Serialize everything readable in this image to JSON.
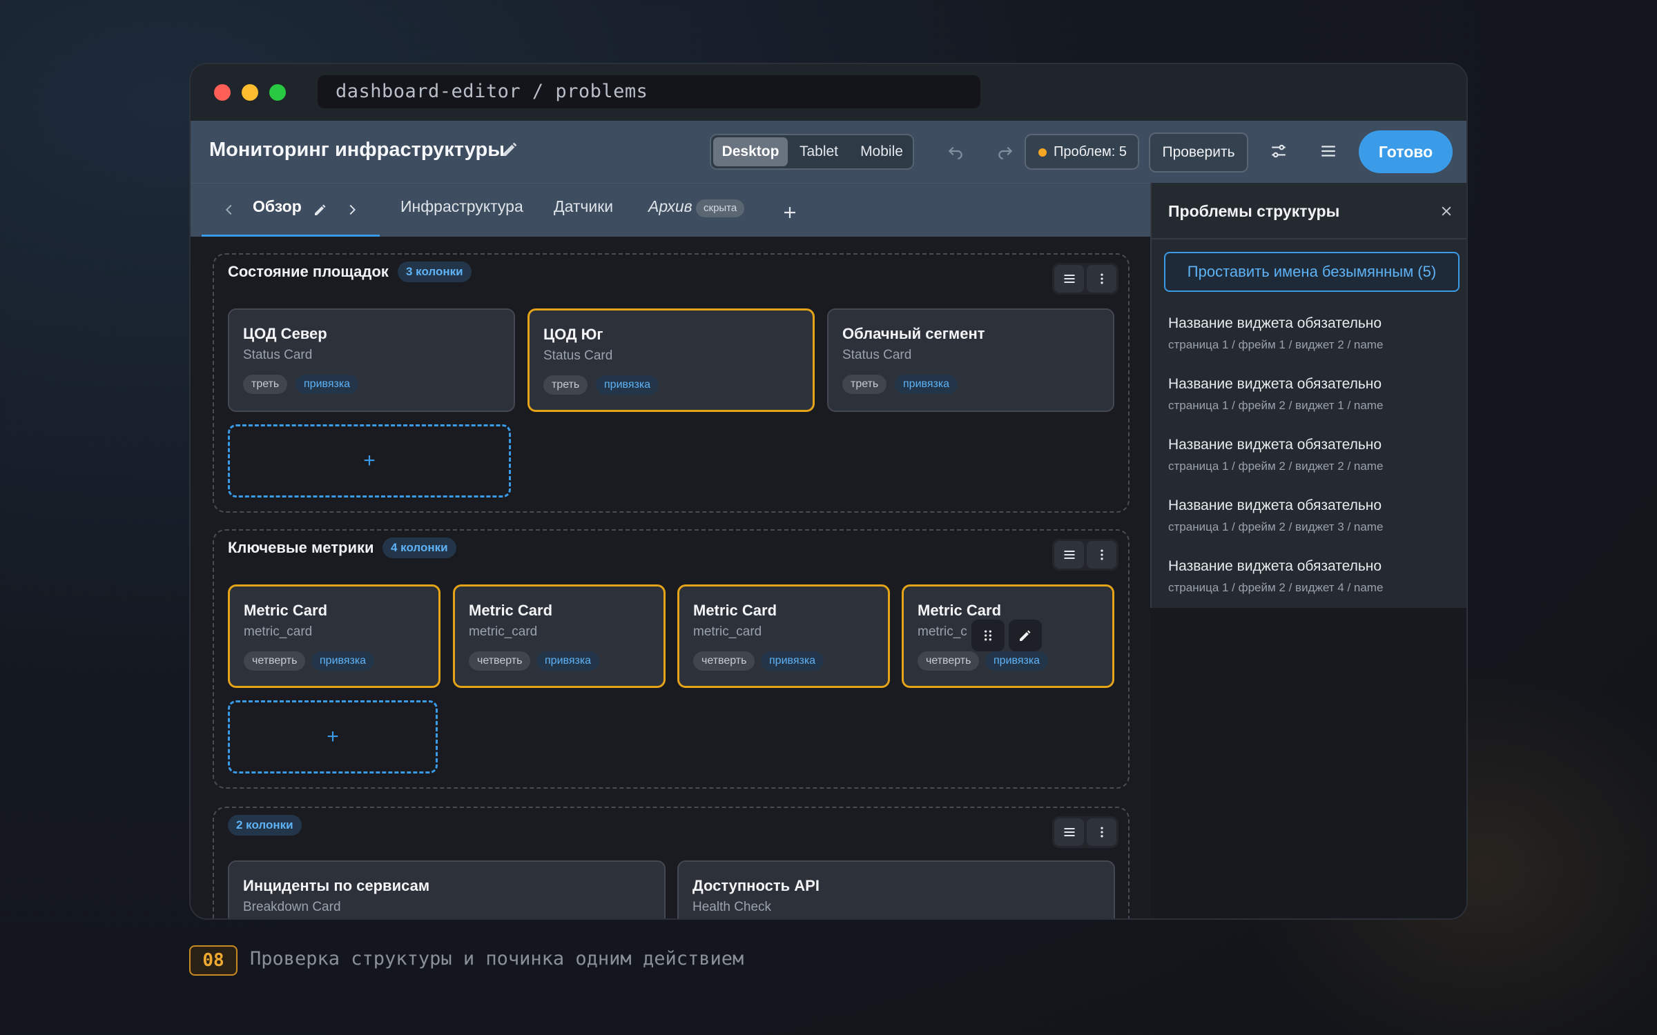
{
  "window": {
    "url": "dashboard-editor / problems"
  },
  "header": {
    "title": "Мониторинг инфраструктуры",
    "devices": [
      "Desktop",
      "Tablet",
      "Mobile"
    ],
    "active_device": "Desktop",
    "problems_label": "Проблем: 5",
    "check_label": "Проверить",
    "done_label": "Готово"
  },
  "tabs": [
    {
      "label": "Обзор",
      "active": true
    },
    {
      "label": "Инфраструктура"
    },
    {
      "label": "Датчики"
    },
    {
      "label": "Архив",
      "badge": "скрыта"
    }
  ],
  "frames": [
    {
      "title": "Состояние площадок",
      "columns_badge": "3 колонки",
      "cards": [
        {
          "title": "ЦОД Север",
          "sub": "Status Card",
          "size": "треть",
          "binding": "привязка",
          "warn": false
        },
        {
          "title": "ЦОД Юг",
          "sub": "Status Card",
          "size": "треть",
          "binding": "привязка",
          "warn": true
        },
        {
          "title": "Облачный сегмент",
          "sub": "Status Card",
          "size": "треть",
          "binding": "привязка",
          "warn": false
        }
      ]
    },
    {
      "title": "Ключевые метрики",
      "columns_badge": "4 колонки",
      "cards": [
        {
          "title": "Metric Card",
          "sub": "metric_card",
          "size": "четверть",
          "binding": "привязка",
          "warn": true
        },
        {
          "title": "Metric Card",
          "sub": "metric_card",
          "size": "четверть",
          "binding": "привязка",
          "warn": true
        },
        {
          "title": "Metric Card",
          "sub": "metric_card",
          "size": "четверть",
          "binding": "привязка",
          "warn": true
        },
        {
          "title": "Metric Card",
          "sub": "metric_c",
          "size": "четверть",
          "binding": "привязка",
          "warn": true
        }
      ]
    },
    {
      "title": "",
      "columns_badge": "2 колонки",
      "cards": [
        {
          "title": "Инциденты по сервисам",
          "sub": "Breakdown Card"
        },
        {
          "title": "Доступность API",
          "sub": "Health Check"
        }
      ]
    }
  ],
  "add_slot_label": "+",
  "panel": {
    "title": "Проблемы структуры",
    "fix_label": "Проставить имена безымянным (5)",
    "issues": [
      {
        "title": "Название виджета обязательно",
        "path": "страница 1 / фрейм 1 / виджет 2 / name"
      },
      {
        "title": "Название виджета обязательно",
        "path": "страница 1 / фрейм 2 / виджет 1 / name"
      },
      {
        "title": "Название виджета обязательно",
        "path": "страница 1 / фрейм 2 / виджет 2 / name"
      },
      {
        "title": "Название виджета обязательно",
        "path": "страница 1 / фрейм 2 / виджет 3 / name"
      },
      {
        "title": "Название виджета обязательно",
        "path": "страница 1 / фрейм 2 / виджет 4 / name"
      }
    ]
  },
  "caption": {
    "number": "08",
    "text": "Проверка структуры и починка одним действием"
  },
  "colors": {
    "accent": "#3a9be8",
    "warning": "#e5a317",
    "done": "#3a9be8"
  }
}
